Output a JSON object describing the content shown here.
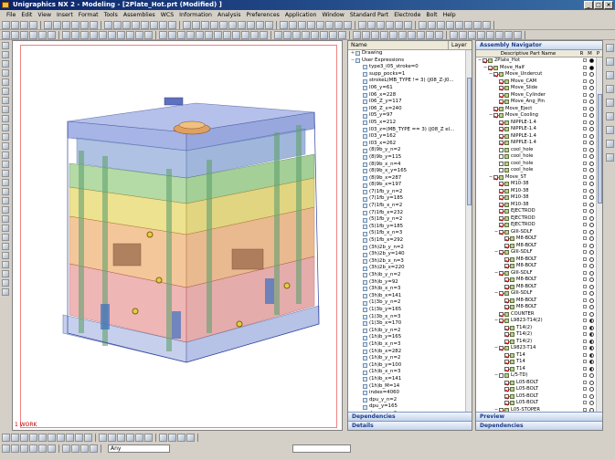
{
  "window": {
    "title": "Unigraphics NX 2 - Modeling - [2Plate_Hot.prt (Modified) ]",
    "buttons": [
      "_",
      "□",
      "×"
    ]
  },
  "menu": [
    "File",
    "Edit",
    "View",
    "Insert",
    "Format",
    "Tools",
    "Assemblies",
    "WCS",
    "Information",
    "Analysis",
    "Preferences",
    "Application",
    "Window",
    "Standard Part",
    "Electrode",
    "Bolt",
    "Help"
  ],
  "viewport": {
    "work_label": "1 WORK"
  },
  "expressions": {
    "columns": {
      "name": "Name",
      "layer": "Layer"
    },
    "nodes": [
      {
        "label": "Drawing",
        "level": 0,
        "expand": "+"
      },
      {
        "label": "User Expressions",
        "level": 0,
        "expand": "-"
      },
      {
        "label": "type3_i05_stroke=0",
        "level": 1
      },
      {
        "label": "supp_pocks=1",
        "level": 1
      },
      {
        "label": "strokeL(MB_TYPE != 3) (J08_Z-J0...",
        "level": 1
      },
      {
        "label": "I06_y=61",
        "level": 1
      },
      {
        "label": "I06_x=228",
        "level": 1
      },
      {
        "label": "I06_Z_y=117",
        "level": 1
      },
      {
        "label": "I06_Z_x=240",
        "level": 1
      },
      {
        "label": "I05_y=97",
        "level": 1
      },
      {
        "label": "I05_x=212",
        "level": 1
      },
      {
        "label": "I03_z=(MB_TYPE == 3) (J08_Z el...",
        "level": 1
      },
      {
        "label": "I03_y=162",
        "level": 1
      },
      {
        "label": "I03_x=262",
        "level": 1
      },
      {
        "label": "(8)9b_y_n=2",
        "level": 1
      },
      {
        "label": "(8)9b_y=115",
        "level": 1
      },
      {
        "label": "(8)9b_x_n=4",
        "level": 1
      },
      {
        "label": "(8)9b_x_y=165",
        "level": 1
      },
      {
        "label": "(8)9b_x=287",
        "level": 1
      },
      {
        "label": "(8)9b_x=197",
        "level": 1
      },
      {
        "label": "(7)1fb_y_n=2",
        "level": 1
      },
      {
        "label": "(7)1fb_y=185",
        "level": 1
      },
      {
        "label": "(7)1fb_x_n=2",
        "level": 1
      },
      {
        "label": "(7)1fb_x=232",
        "level": 1
      },
      {
        "label": "(5)1fb_y_n=2",
        "level": 1
      },
      {
        "label": "(5)1fb_y=185",
        "level": 1
      },
      {
        "label": "(5)1fb_x_n=3",
        "level": 1
      },
      {
        "label": "(5)1fb_x=292",
        "level": 1
      },
      {
        "label": "(3h)2b_y_n=2",
        "level": 1
      },
      {
        "label": "(3h)2b_y=140",
        "level": 1
      },
      {
        "label": "(3h)2b_x_n=3",
        "level": 1
      },
      {
        "label": "(3h)2b_x=220",
        "level": 1
      },
      {
        "label": "(3h)b_y_n=2",
        "level": 1
      },
      {
        "label": "(3h)b_y=92",
        "level": 1
      },
      {
        "label": "(3h)b_x_n=3",
        "level": 1
      },
      {
        "label": "(3h)b_x=141",
        "level": 1
      },
      {
        "label": "(1)3b_y_n=2",
        "level": 1
      },
      {
        "label": "(1)3b_y=165",
        "level": 1
      },
      {
        "label": "(1)3b_x_n=3",
        "level": 1
      },
      {
        "label": "(1)3b_x=170",
        "level": 1
      },
      {
        "label": "(1h)b_y_n=2",
        "level": 1
      },
      {
        "label": "(1h)b_y=165",
        "level": 1
      },
      {
        "label": "(1h)b_x_n=3",
        "level": 1
      },
      {
        "label": "(1h)b_x=282",
        "level": 1
      },
      {
        "label": "(1h)b_y_n=2",
        "level": 1
      },
      {
        "label": "(1h)b_y=100",
        "level": 1
      },
      {
        "label": "(1h)b_x_n=3",
        "level": 1
      },
      {
        "label": "(1h)b_x=141",
        "level": 1
      },
      {
        "label": "(1h)b_M=14",
        "level": 1
      },
      {
        "label": "index=4060",
        "level": 1
      },
      {
        "label": "dpu_y_n=2",
        "level": 1
      },
      {
        "label": "dpu_y=165",
        "level": 1
      },
      {
        "label": "dpu_x_n=2",
        "level": 1
      },
      {
        "label": "dpu_x=170",
        "level": 1
      },
      {
        "label": "dpl_y_n=2",
        "level": 1
      },
      {
        "label": "dpl_y=165",
        "level": 1
      },
      {
        "label": "dpl_x_n=2",
        "level": 1
      }
    ],
    "footer": [
      "Dependencies",
      "Details"
    ]
  },
  "assembly": {
    "title": "Assembly Navigator",
    "columns": {
      "name": "Descriptive Part Name",
      "r": "R",
      "m": "M",
      "p": "P"
    },
    "nodes": [
      {
        "label": "2Plate_Hot",
        "level": 0,
        "expand": "-",
        "checked": true,
        "p": "full"
      },
      {
        "label": "Move_Half",
        "level": 1,
        "expand": "-",
        "checked": true,
        "p": "full"
      },
      {
        "label": "Move_Undercut",
        "level": 2,
        "expand": "-",
        "checked": true,
        "p": "empty"
      },
      {
        "label": "Move_CAM",
        "level": 3,
        "checked": true,
        "p": "empty"
      },
      {
        "label": "Move_Slide",
        "level": 3,
        "checked": true,
        "p": "empty"
      },
      {
        "label": "Move_Cylinder",
        "level": 3,
        "checked": true,
        "p": "empty"
      },
      {
        "label": "Move_Ang_Pin",
        "level": 3,
        "checked": true,
        "p": "empty"
      },
      {
        "label": "Move_Eject",
        "level": 2,
        "checked": true,
        "p": "empty"
      },
      {
        "label": "Move_Cooling",
        "level": 2,
        "expand": "-",
        "checked": true,
        "p": "empty"
      },
      {
        "label": "NIPPLE-1.4",
        "level": 3,
        "checked": true,
        "p": "empty"
      },
      {
        "label": "NIPPLE-1.4",
        "level": 3,
        "checked": true,
        "p": "empty"
      },
      {
        "label": "NIPPLE-1.4",
        "level": 3,
        "checked": true,
        "p": "empty"
      },
      {
        "label": "NIPPLE-1.4",
        "level": 3,
        "checked": true,
        "p": "empty"
      },
      {
        "label": "cool_hole",
        "level": 3,
        "checked": false,
        "p": "empty"
      },
      {
        "label": "cool_hole",
        "level": 3,
        "checked": false,
        "p": "empty"
      },
      {
        "label": "cool_hole",
        "level": 3,
        "checked": false,
        "p": "empty"
      },
      {
        "label": "cool_hole",
        "level": 3,
        "checked": false,
        "p": "empty"
      },
      {
        "label": "Move_ST",
        "level": 2,
        "expand": "-",
        "checked": true,
        "p": "empty"
      },
      {
        "label": "M10-38",
        "level": 3,
        "checked": true,
        "p": "empty"
      },
      {
        "label": "M10-38",
        "level": 3,
        "checked": true,
        "p": "empty"
      },
      {
        "label": "M10-38",
        "level": 3,
        "checked": true,
        "p": "empty"
      },
      {
        "label": "M10-38",
        "level": 3,
        "checked": true,
        "p": "empty"
      },
      {
        "label": "EJECTROD",
        "level": 3,
        "checked": true,
        "p": "empty"
      },
      {
        "label": "EJECTROD",
        "level": 3,
        "checked": true,
        "p": "empty"
      },
      {
        "label": "EJECTROD",
        "level": 3,
        "checked": true,
        "p": "empty"
      },
      {
        "label": "GIII-SDLF",
        "level": 3,
        "expand": "-",
        "checked": true,
        "p": "empty"
      },
      {
        "label": "M8-BOLT",
        "level": 4,
        "checked": true,
        "p": "empty"
      },
      {
        "label": "M8-BOLT",
        "level": 4,
        "checked": true,
        "p": "empty"
      },
      {
        "label": "GIII-SDLF",
        "level": 3,
        "expand": "-",
        "checked": true,
        "p": "empty"
      },
      {
        "label": "M8-BOLT",
        "level": 4,
        "checked": true,
        "p": "empty"
      },
      {
        "label": "M8-BOLT",
        "level": 4,
        "checked": true,
        "p": "empty"
      },
      {
        "label": "GIII-SDLF",
        "level": 3,
        "expand": "-",
        "checked": true,
        "p": "empty"
      },
      {
        "label": "M8-BOLT",
        "level": 4,
        "checked": true,
        "p": "empty"
      },
      {
        "label": "M8-BOLT",
        "level": 4,
        "checked": true,
        "p": "empty"
      },
      {
        "label": "GIII-SDLF",
        "level": 3,
        "expand": "-",
        "checked": true,
        "p": "empty"
      },
      {
        "label": "M8-BOLT",
        "level": 4,
        "checked": true,
        "p": "empty"
      },
      {
        "label": "M8-BOLT",
        "level": 4,
        "checked": true,
        "p": "empty"
      },
      {
        "label": "COUNTER",
        "level": 3,
        "checked": true,
        "p": "empty"
      },
      {
        "label": "L9823-T14(2)",
        "level": 3,
        "expand": "-",
        "checked": true,
        "p": "half"
      },
      {
        "label": "T14(2)",
        "level": 4,
        "checked": true,
        "p": "half"
      },
      {
        "label": "T14(2)",
        "level": 4,
        "checked": true,
        "p": "half"
      },
      {
        "label": "T14(2)",
        "level": 4,
        "checked": true,
        "p": "half"
      },
      {
        "label": "L9823-T14",
        "level": 3,
        "expand": "-",
        "checked": true,
        "p": "half"
      },
      {
        "label": "T14",
        "level": 4,
        "checked": true,
        "p": "half"
      },
      {
        "label": "T14",
        "level": 4,
        "checked": true,
        "p": "half"
      },
      {
        "label": "T14",
        "level": 4,
        "checked": true,
        "p": "half"
      },
      {
        "label": "L/5-TD)",
        "level": 3,
        "expand": "-",
        "checked": false,
        "p": "empty"
      },
      {
        "label": "L05-BOLT",
        "level": 4,
        "checked": true,
        "p": "empty"
      },
      {
        "label": "L05-BOLT",
        "level": 4,
        "checked": true,
        "p": "empty"
      },
      {
        "label": "L05-BOLT",
        "level": 4,
        "checked": true,
        "p": "empty"
      },
      {
        "label": "L05-BOLT",
        "level": 4,
        "checked": true,
        "p": "empty"
      },
      {
        "label": "L05-STOPER",
        "level": 3,
        "expand": "-",
        "checked": true,
        "p": "empty"
      },
      {
        "label": "L05-N06",
        "level": 4,
        "checked": true,
        "p": "empty"
      },
      {
        "label": "L05-N06",
        "level": 4,
        "checked": true,
        "p": "empty"
      },
      {
        "label": "L05-N06",
        "level": 4,
        "checked": true,
        "p": "empty"
      }
    ],
    "footer": [
      "Preview",
      "Dependencies"
    ]
  },
  "status": {
    "filter_value": "Any"
  }
}
